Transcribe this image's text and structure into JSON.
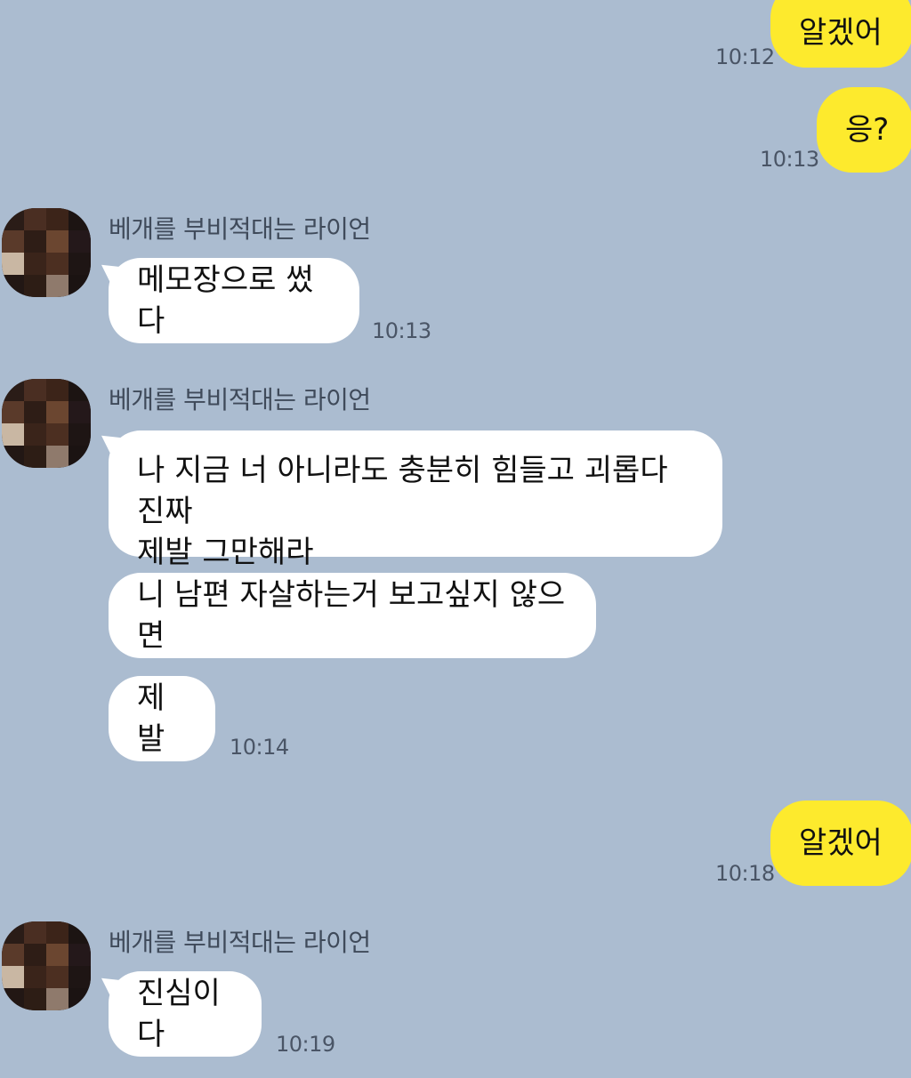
{
  "colors": {
    "background": "#abbcd0",
    "my_bubble": "#fdea2d",
    "their_bubble": "#ffffff"
  },
  "messages": [
    {
      "from": "me",
      "text": "알겠어",
      "time": "10:12"
    },
    {
      "from": "me",
      "text": "응?",
      "time": "10:13"
    },
    {
      "from": "them",
      "sender": "베개를 부비적대는 라이언",
      "text": "메모장으로 썼다",
      "time": "10:13"
    },
    {
      "from": "them",
      "sender": "베개를 부비적대는 라이언",
      "text": "나 지금 너 아니라도 충분히 힘들고 괴롭다 진짜\n제발 그만해라"
    },
    {
      "from": "them",
      "text": "니 남편 자살하는거 보고싶지 않으면"
    },
    {
      "from": "them",
      "text": "제발",
      "time": "10:14"
    },
    {
      "from": "me",
      "text": "알겠어",
      "time": "10:18"
    },
    {
      "from": "them",
      "sender": "베개를 부비적대는 라이언",
      "text": "진심이다",
      "time": "10:19"
    }
  ]
}
